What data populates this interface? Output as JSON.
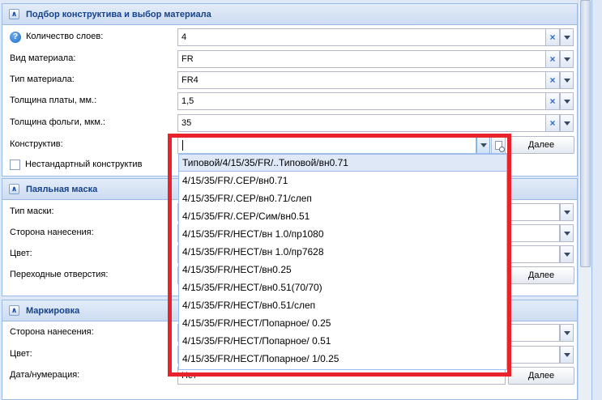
{
  "sections": {
    "construct": {
      "title": "Подбор конструктива и выбор материала",
      "layers": {
        "label": "Количество слоев:",
        "value": "4"
      },
      "material_kind": {
        "label": "Вид материала:",
        "value": "FR"
      },
      "material_type": {
        "label": "Тип материала:",
        "value": "FR4"
      },
      "board_thickness": {
        "label": "Толщина платы, мм.:",
        "value": "1,5"
      },
      "foil_thickness": {
        "label": "Толщина фольги, мкм.:",
        "value": "35"
      },
      "constructive": {
        "label": "Конструктив:",
        "value": "",
        "more": "Далее"
      },
      "nonstandard": {
        "label": "Нестандартный конструктив",
        "checked": false
      }
    },
    "solder_mask": {
      "title": "Паяльная маска",
      "mask_type": {
        "label": "Тип маски:"
      },
      "side": {
        "label": "Сторона нанесения:"
      },
      "color": {
        "label": "Цвет:"
      },
      "vias": {
        "label": "Переходные отверстия:",
        "more": "Далее"
      }
    },
    "marking": {
      "title": "Маркировка",
      "side": {
        "label": "Сторона нанесения:"
      },
      "color": {
        "label": "Цвет:"
      },
      "numbering": {
        "label": "Дата/нумерация:",
        "value": "Нет",
        "more": "Далее"
      }
    }
  },
  "dropdown": {
    "selected_index": 0,
    "options": [
      "Типовой/4/15/35/FR/..Типовой/вн0.71",
      "4/15/35/FR/.СЕР/вн0.71",
      "4/15/35/FR/.СЕР/вн0.71/слеп",
      "4/15/35/FR/.СЕР/Сим/вн0.51",
      "4/15/35/FR/НЕСТ/вн 1.0/пр1080",
      "4/15/35/FR/НЕСТ/вн 1.0/пр7628",
      "4/15/35/FR/НЕСТ/вн0.25",
      "4/15/35/FR/НЕСТ/вн0.51(70/70)",
      "4/15/35/FR/НЕСТ/вн0.51/слеп",
      "4/15/35/FR/НЕСТ/Попарное/ 0.25",
      "4/15/35/FR/НЕСТ/Попарное/ 0.51",
      "4/15/35/FR/НЕСТ/Попарное/ 1/0.25"
    ]
  },
  "icons": {
    "collapse": "double-chevron-up-icon",
    "help": "question-icon",
    "clear": "clear-x-icon",
    "arrow": "chevron-down-icon",
    "lookup": "lookup-icon"
  },
  "colors": {
    "highlight": "#e8232b",
    "panel_title": "#15428b",
    "clear_x": "#2e6bc6"
  }
}
